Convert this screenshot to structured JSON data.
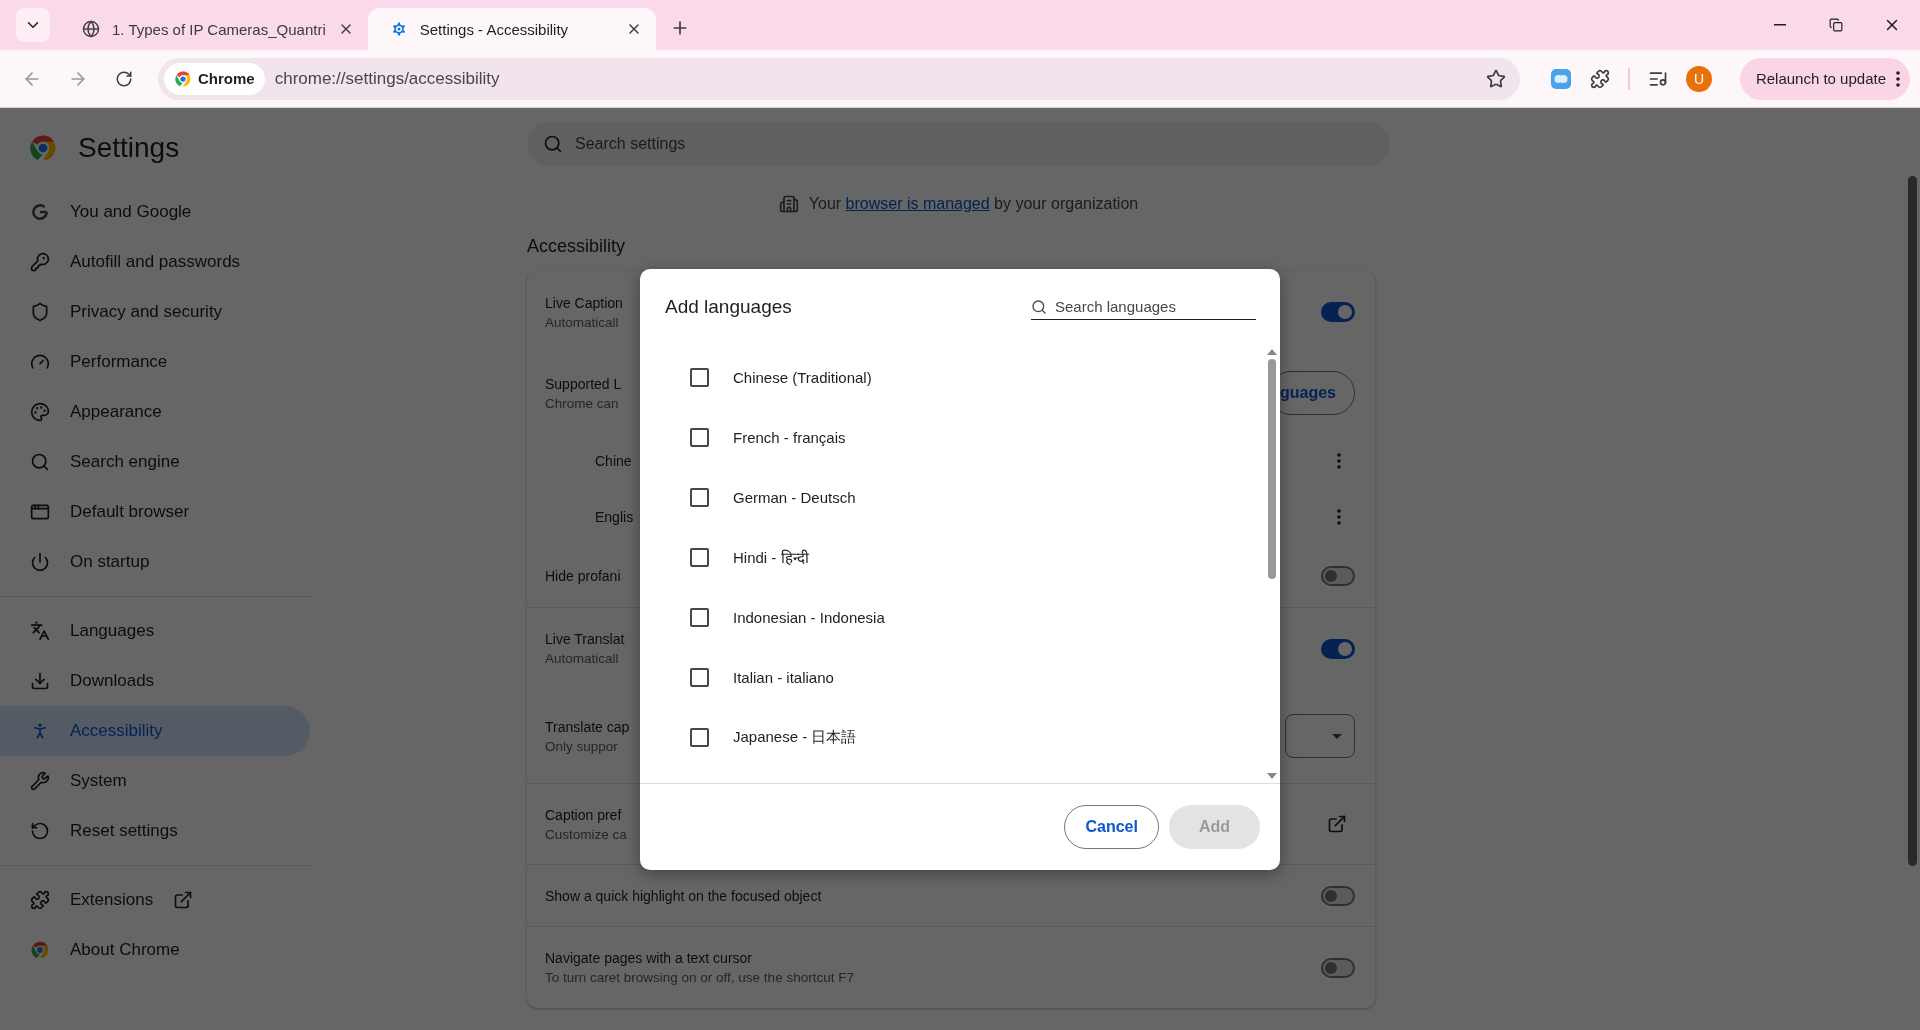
{
  "tabs": [
    {
      "kind": "web",
      "title": "1. Types of IP Cameras_Quantri",
      "selected": false
    },
    {
      "kind": "settings",
      "title": "Settings - Accessibility",
      "selected": true
    }
  ],
  "toolbar": {
    "chip": "Chrome",
    "url": "chrome://settings/accessibility",
    "avatar": "U",
    "relaunch": "Relaunch to update"
  },
  "settings": {
    "title": "Settings",
    "search_placeholder": "Search settings"
  },
  "sidebar": {
    "groups": [
      {
        "items": [
          {
            "label": "You and Google",
            "selected": false
          },
          {
            "label": "Autofill and passwords",
            "selected": false
          },
          {
            "label": "Privacy and security",
            "selected": false
          },
          {
            "label": "Performance",
            "selected": false
          },
          {
            "label": "Appearance",
            "selected": false
          },
          {
            "label": "Search engine",
            "selected": false
          },
          {
            "label": "Default browser",
            "selected": false
          },
          {
            "label": "On startup",
            "selected": false
          }
        ]
      },
      {
        "items": [
          {
            "label": "Languages",
            "selected": false
          },
          {
            "label": "Downloads",
            "selected": false
          },
          {
            "label": "Accessibility",
            "selected": true
          },
          {
            "label": "System",
            "selected": false
          },
          {
            "label": "Reset settings",
            "selected": false
          }
        ]
      },
      {
        "items": [
          {
            "label": "Extensions",
            "selected": false,
            "external": true
          },
          {
            "label": "About Chrome",
            "selected": false
          }
        ]
      }
    ]
  },
  "managed_notice": {
    "before": "Your",
    "link": "browser is managed",
    "after": "by your organization"
  },
  "section_title": "Accessibility",
  "rows": [
    {
      "kind": "toggle",
      "title": "Live Caption",
      "subtitle": "Automaticall",
      "on": true
    },
    {
      "kind": "button",
      "title": "Supported L",
      "subtitle": "Chrome can",
      "button": "guages"
    },
    {
      "kind": "language",
      "title": "Chine"
    },
    {
      "kind": "language",
      "title": "Englis"
    },
    {
      "kind": "toggle",
      "title": "Hide profani",
      "on": false
    },
    {
      "kind": "toggle",
      "title": "Live Translat",
      "subtitle": "Automaticall",
      "on": true
    },
    {
      "kind": "select",
      "title": "Translate cap",
      "subtitle": "Only suppor"
    },
    {
      "kind": "external",
      "title": "Caption pref",
      "subtitle": "Customize ca"
    },
    {
      "kind": "toggle",
      "title": "Show a quick highlight on the focused object",
      "on": false
    },
    {
      "kind": "toggle",
      "title": "Navigate pages with a text cursor",
      "subtitle": "To turn caret browsing on or off, use the shortcut F7",
      "on": false
    }
  ],
  "dialog": {
    "title": "Add languages",
    "search_placeholder": "Search languages",
    "languages": [
      {
        "name": "Chinese (Traditional)",
        "checked": false
      },
      {
        "name": "French - français",
        "checked": false
      },
      {
        "name": "German - Deutsch",
        "checked": false
      },
      {
        "name": "Hindi - हिन्दी",
        "checked": false
      },
      {
        "name": "Indonesian - Indonesia",
        "checked": false
      },
      {
        "name": "Italian - italiano",
        "checked": false
      },
      {
        "name": "Japanese - 日本語",
        "checked": false
      }
    ],
    "cancel": "Cancel",
    "add": {
      "label": "Add",
      "disabled": true
    }
  }
}
